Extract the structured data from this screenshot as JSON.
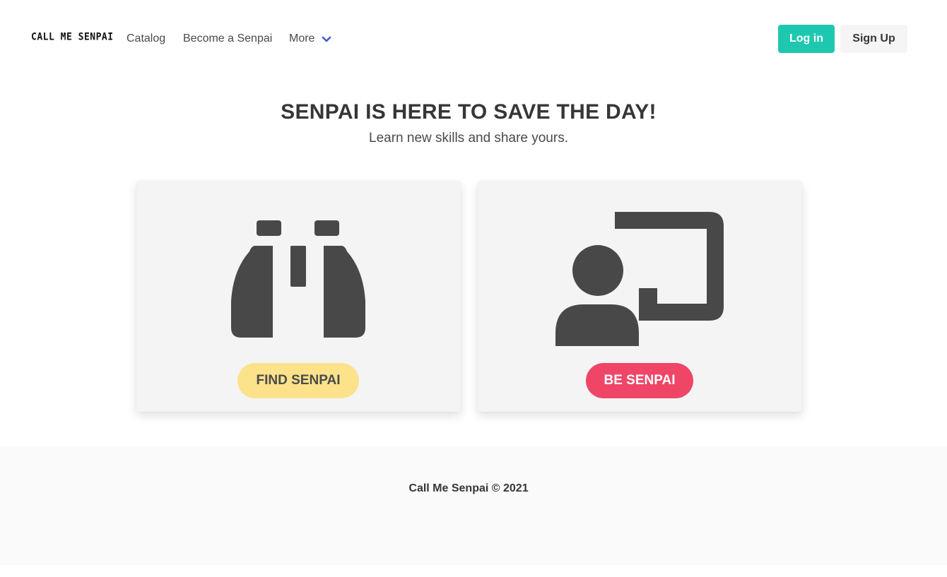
{
  "navbar": {
    "logo_text": "CALL ME SENPAI",
    "links": {
      "catalog": "Catalog",
      "become": "Become a Senpai",
      "more": "More"
    },
    "login_label": "Log in",
    "signup_label": "Sign Up"
  },
  "hero": {
    "title": "SENPAI IS HERE TO SAVE THE DAY!",
    "subtitle": "Learn new skills and share yours."
  },
  "cards": {
    "find": {
      "icon": "binoculars-icon",
      "button_label": "FIND SENPAI"
    },
    "be": {
      "icon": "chalkboard-teacher-icon",
      "button_label": "BE SENPAI"
    }
  },
  "footer": {
    "text": "Call Me Senpai © 2021"
  },
  "colors": {
    "accent_teal": "#1ec8b0",
    "find_yellow": "#fbe28b",
    "be_pink": "#ef4668",
    "icon_gray": "#484848",
    "chevron_blue": "#3e5bd1"
  }
}
